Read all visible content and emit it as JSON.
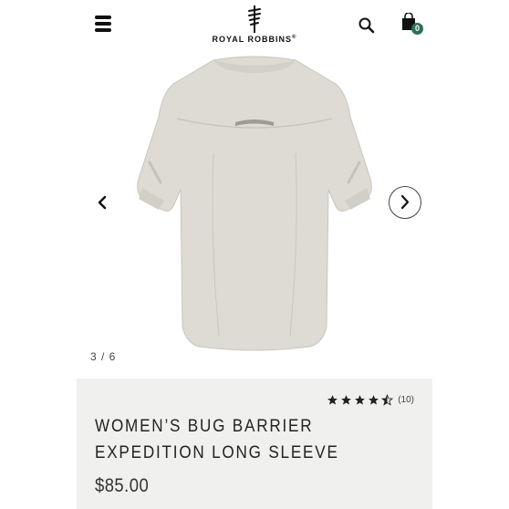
{
  "header": {
    "brand": "ROYAL ROBBINS",
    "brand_suffix": "®",
    "cart_count": "0",
    "icons": [
      "menu-icon",
      "brand-logo-icon",
      "search-icon",
      "shopping-bag-icon"
    ]
  },
  "gallery": {
    "counter": "3 / 6",
    "current_image": 3,
    "total_images": 6,
    "icons": [
      "chevron-left-icon",
      "chevron-right-icon"
    ]
  },
  "product": {
    "name": "WOMEN’S BUG BARRIER EXPEDITION LONG SLEEVE",
    "price": "$85.00",
    "rating": 4.5,
    "rating_max": 5,
    "review_count": "(10)"
  },
  "colors": {
    "shirt": "#dddbd3",
    "info_panel": "#f0f0ef",
    "badge": "#2f6e5a"
  }
}
